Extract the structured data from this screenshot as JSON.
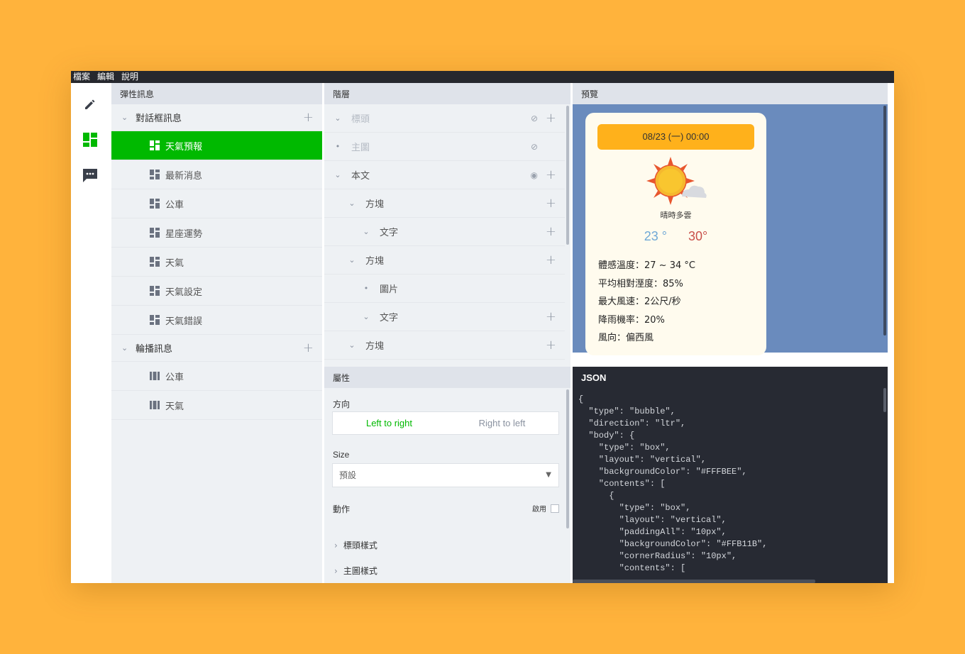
{
  "menu": [
    "檔案",
    "編輯",
    "說明"
  ],
  "sidebar_icons": [
    "pencil-icon",
    "dashboard-icon",
    "chat-icon"
  ],
  "left": {
    "title": "彈性訊息",
    "groups": [
      {
        "label": "對話框訊息",
        "items": [
          "天氣預報",
          "最新消息",
          "公車",
          "星座運勢",
          "天氣",
          "天氣設定",
          "天氣錯誤"
        ],
        "active": 0
      },
      {
        "label": "輪播訊息",
        "items": [
          "公車",
          "天氣"
        ]
      }
    ]
  },
  "layers": {
    "title": "階層",
    "rows": [
      {
        "label": "標頭",
        "dim": true,
        "eye": "hidden",
        "plus": true
      },
      {
        "label": "主圖",
        "dim": true,
        "eye": "hidden",
        "plus": false
      },
      {
        "label": "本文",
        "dim": false,
        "eye": "visible",
        "plus": true
      },
      {
        "label": "方塊",
        "dim": false,
        "plus": true
      },
      {
        "label": "文字",
        "dim": false,
        "plus": true
      },
      {
        "label": "方塊",
        "dim": false,
        "plus": true
      },
      {
        "label": "圖片",
        "dim": false,
        "plus": false
      },
      {
        "label": "文字",
        "dim": false,
        "plus": true
      },
      {
        "label": "方塊",
        "dim": false,
        "plus": true
      }
    ]
  },
  "props": {
    "title": "屬性",
    "direction_label": "方向",
    "ltr": "Left to right",
    "rtl": "Right to left",
    "size_label": "Size",
    "size_value": "預設",
    "action_label": "動作",
    "enable_label": "啟用",
    "header_style": "標頭樣式",
    "hero_style": "主圖樣式"
  },
  "preview": {
    "title": "預覽",
    "date": "08/23 (一) 00:00",
    "condition": "晴時多雲",
    "low": "23 °",
    "high": "30°",
    "info": [
      "體感溫度：27 ~ 34 °C",
      "平均相對溼度：85%",
      "最大風速：2公尺/秒",
      "降雨機率：20%",
      "風向：偏西風"
    ]
  },
  "json": {
    "title": "JSON",
    "code": "{\n  \"type\": \"bubble\",\n  \"direction\": \"ltr\",\n  \"body\": {\n    \"type\": \"box\",\n    \"layout\": \"vertical\",\n    \"backgroundColor\": \"#FFFBEE\",\n    \"contents\": [\n      {\n        \"type\": \"box\",\n        \"layout\": \"vertical\",\n        \"paddingAll\": \"10px\",\n        \"backgroundColor\": \"#FFB11B\",\n        \"cornerRadius\": \"10px\",\n        \"contents\": ["
  },
  "colors": {
    "accent": "#00b900",
    "background": "#FFB33C",
    "preview_bg": "#6a8bbd",
    "bubble_bg": "#FFFBEE",
    "header_bg": "#FFB11B"
  }
}
